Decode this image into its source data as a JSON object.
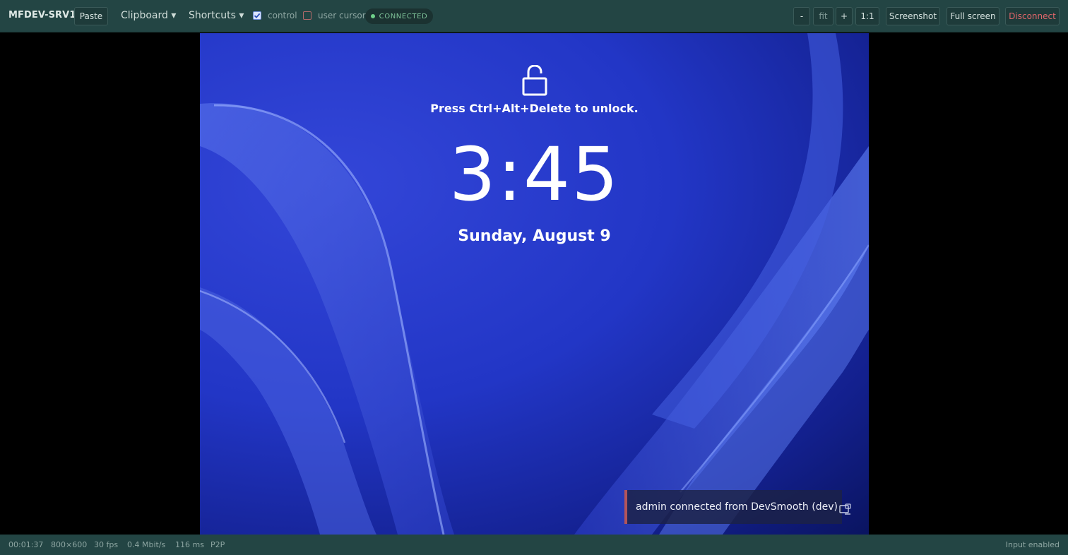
{
  "toolbar": {
    "host_name": "MFDEV-SRV1",
    "paste_label": "Paste",
    "clipboard_label": "Clipboard ▾",
    "shortcuts_label": "Shortcuts ▾",
    "control_label": "control",
    "control_checked": true,
    "user_cursor_label": "user cursor",
    "user_cursor_checked": false,
    "status_label": "CONNECTED",
    "zoom_out_label": "-",
    "fit_label": "fit",
    "zoom_in_label": "+",
    "one_to_one_label": "1:1",
    "screenshot_label": "Screenshot",
    "fullscreen_label": "Full screen",
    "disconnect_label": "Disconnect",
    "status_color": "#6fd08a",
    "disconnect_color": "#e0666a"
  },
  "remote_screen": {
    "unlock_prompt": "Press Ctrl+Alt+Delete to unlock.",
    "time": "3:45",
    "date": "Sunday, August 9",
    "lock_icon": "unlocked-padlock-icon"
  },
  "toast": {
    "message": "admin connected from DevSmooth (dev)",
    "icon": "remote-session-icon"
  },
  "status_bar": {
    "elapsed": "00:01:37",
    "resolution": "800×600",
    "fps": "30 fps",
    "bitrate": "0.4 Mbit/s",
    "latency": "116 ms",
    "mode": "P2P",
    "input_state": "Input enabled"
  }
}
